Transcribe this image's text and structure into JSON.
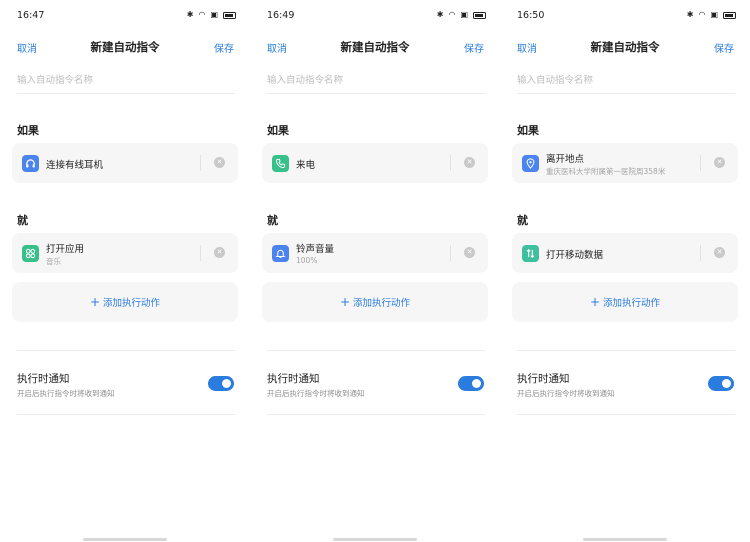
{
  "common": {
    "cancel_label": "取消",
    "title": "新建自动指令",
    "save_label": "保存",
    "name_placeholder": "输入自动指令名称",
    "if_label": "如果",
    "then_label": "就",
    "add_action_label": "添加执行动作",
    "notify_title": "执行时通知",
    "notify_desc": "开启后执行指令时将收到通知",
    "notify_enabled": true
  },
  "colors": {
    "accent": "#2a7cde",
    "icon_blue": "#4b84ee",
    "icon_green": "#37c08a",
    "icon_teal": "#3fbf9c"
  },
  "screens": [
    {
      "time": "16:47",
      "trigger": {
        "icon": "headphones-icon",
        "title": "连接有线耳机"
      },
      "action": {
        "icon": "apps-icon",
        "title": "打开应用",
        "subtitle": "音乐"
      }
    },
    {
      "time": "16:49",
      "trigger": {
        "icon": "phone-icon",
        "title": "来电"
      },
      "action": {
        "icon": "bell-icon",
        "title": "铃声音量",
        "subtitle": "100%"
      }
    },
    {
      "time": "16:50",
      "trigger": {
        "icon": "location-pin-icon",
        "title": "离开地点",
        "subtitle": "重庆医科大学附属第一医院周358米"
      },
      "action": {
        "icon": "mobile-data-icon",
        "title": "打开移动数据"
      }
    }
  ]
}
